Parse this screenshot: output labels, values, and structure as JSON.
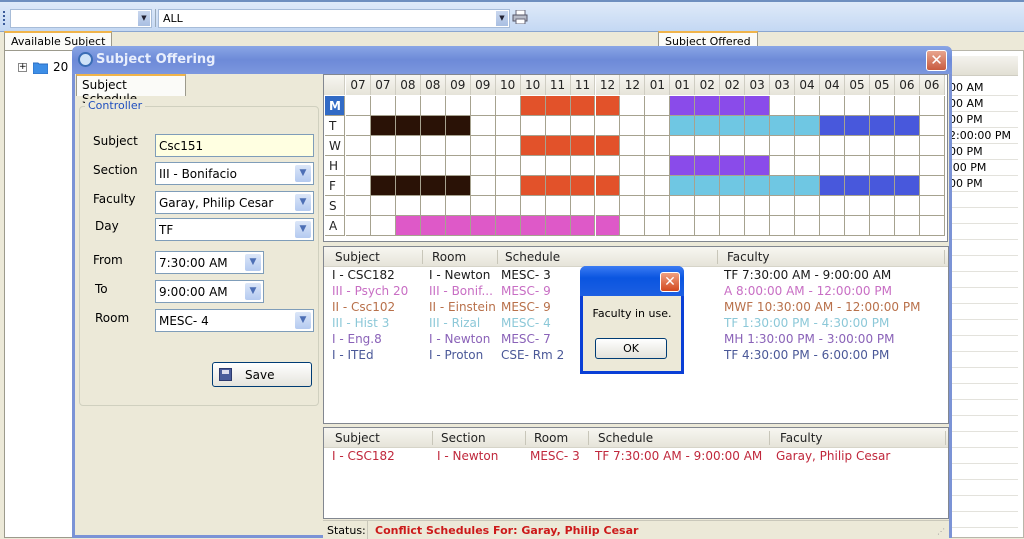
{
  "toolbar": {
    "combo1_value": "",
    "combo2_value": "ALL",
    "print_icon": "printer-icon"
  },
  "background": {
    "left_tab": "Available Subject",
    "right_tab": "Subject Offered",
    "tree_node_label": "20",
    "right_times": [
      "00 AM",
      "00 AM",
      "00 PM",
      "2:00:00 PM",
      "00 PM",
      ":00 PM",
      "00 PM"
    ]
  },
  "dialog": {
    "title": "Subject Offering",
    "close_label": "✕",
    "tab_label": "Subject Schedule",
    "controller": {
      "legend": "Controller",
      "subject_label": "Subject",
      "subject_value": "Csc151",
      "section_label": "Section",
      "section_value": "III - Bonifacio",
      "faculty_label": "Faculty",
      "faculty_value": "Garay, Philip Cesar",
      "day_label": "Day",
      "day_value": "TF",
      "from_label": "From",
      "from_value": "7:30:00 AM",
      "to_label": "To",
      "to_value": "9:00:00 AM",
      "room_label": "Room",
      "room_value": "MESC- 4",
      "save_label": "Save"
    },
    "grid": {
      "time_headers": [
        "07",
        "07",
        "08",
        "08",
        "09",
        "09",
        "10",
        "10",
        "11",
        "11",
        "12",
        "12",
        "01",
        "01",
        "02",
        "02",
        "03",
        "03",
        "04",
        "04",
        "05",
        "05",
        "06",
        "06"
      ],
      "days": [
        "M",
        "T",
        "W",
        "H",
        "F",
        "S",
        "A"
      ],
      "selected_day": "M",
      "colors": {
        "dark": "#2a1206",
        "red": "#e2522a",
        "purple": "#8a4bea",
        "cyan": "#6fc7e3",
        "blue": "#4858dc",
        "pink": "#de59c8"
      },
      "blocks": [
        {
          "day": "M",
          "start": 7,
          "end": 10,
          "color": "red"
        },
        {
          "day": "M",
          "start": 13,
          "end": 16,
          "color": "purple"
        },
        {
          "day": "T",
          "start": 1,
          "end": 4,
          "color": "dark"
        },
        {
          "day": "T",
          "start": 13,
          "end": 18,
          "color": "cyan"
        },
        {
          "day": "T",
          "start": 19,
          "end": 22,
          "color": "blue"
        },
        {
          "day": "W",
          "start": 7,
          "end": 10,
          "color": "red"
        },
        {
          "day": "H",
          "start": 13,
          "end": 16,
          "color": "purple"
        },
        {
          "day": "F",
          "start": 1,
          "end": 4,
          "color": "dark"
        },
        {
          "day": "F",
          "start": 7,
          "end": 10,
          "color": "red"
        },
        {
          "day": "F",
          "start": 13,
          "end": 18,
          "color": "cyan"
        },
        {
          "day": "F",
          "start": 19,
          "end": 22,
          "color": "blue"
        },
        {
          "day": "A",
          "start": 2,
          "end": 10,
          "color": "pink"
        }
      ]
    },
    "schedule_list": {
      "headers": [
        "Subject",
        "Room",
        "Schedule",
        "Faculty"
      ],
      "rows": [
        {
          "subject": "I - CSC182",
          "room": "I - Newton",
          "schedule": "MESC- 3",
          "faculty": "TF 7:30:00 AM - 9:00:00 AM",
          "color": "#1a1a1a"
        },
        {
          "subject": "III - Psych 20",
          "room": "III - Bonif...",
          "schedule": "MESC- 9",
          "faculty": "A 8:00:00 AM - 12:00:00 PM",
          "color": "#c86ec4"
        },
        {
          "subject": "II - Csc102",
          "room": "II - Einstein",
          "schedule": "MESC- 9",
          "faculty": "MWF 10:30:00 AM - 12:00:00 PM",
          "color": "#b8704a"
        },
        {
          "subject": "III - Hist 3",
          "room": "III - Rizal",
          "schedule": "MESC- 4",
          "faculty": "TF 1:30:00 PM - 4:30:00 PM",
          "color": "#8cc8d8"
        },
        {
          "subject": "I - Eng.8",
          "room": "I - Newton",
          "schedule": "MESC- 7",
          "faculty": "MH 1:30:00 PM - 3:00:00 PM",
          "color": "#8a62b8"
        },
        {
          "subject": "I - ITEd",
          "room": "I - Proton",
          "schedule": "CSE- Rm 2",
          "faculty": "TF 4:30:00 PM - 6:00:00 PM",
          "color": "#4a5898"
        }
      ]
    },
    "conflict_list": {
      "headers": [
        "Subject",
        "Section",
        "Room",
        "Schedule",
        "Faculty"
      ],
      "rows": [
        {
          "subject": "I - CSC182",
          "section": "I - Newton",
          "room": "MESC- 3",
          "schedule": "TF 7:30:00 AM - 9:00:00 AM",
          "faculty": "Garay, Philip Cesar",
          "color": "#c0283c"
        }
      ]
    },
    "status": {
      "label": "Status:",
      "message": "Conflict Schedules For: Garay, Philip Cesar",
      "message_color": "#cc1a1a"
    }
  },
  "message_box": {
    "text": "Faculty in use.",
    "ok_label": "OK",
    "close_label": "✕"
  }
}
